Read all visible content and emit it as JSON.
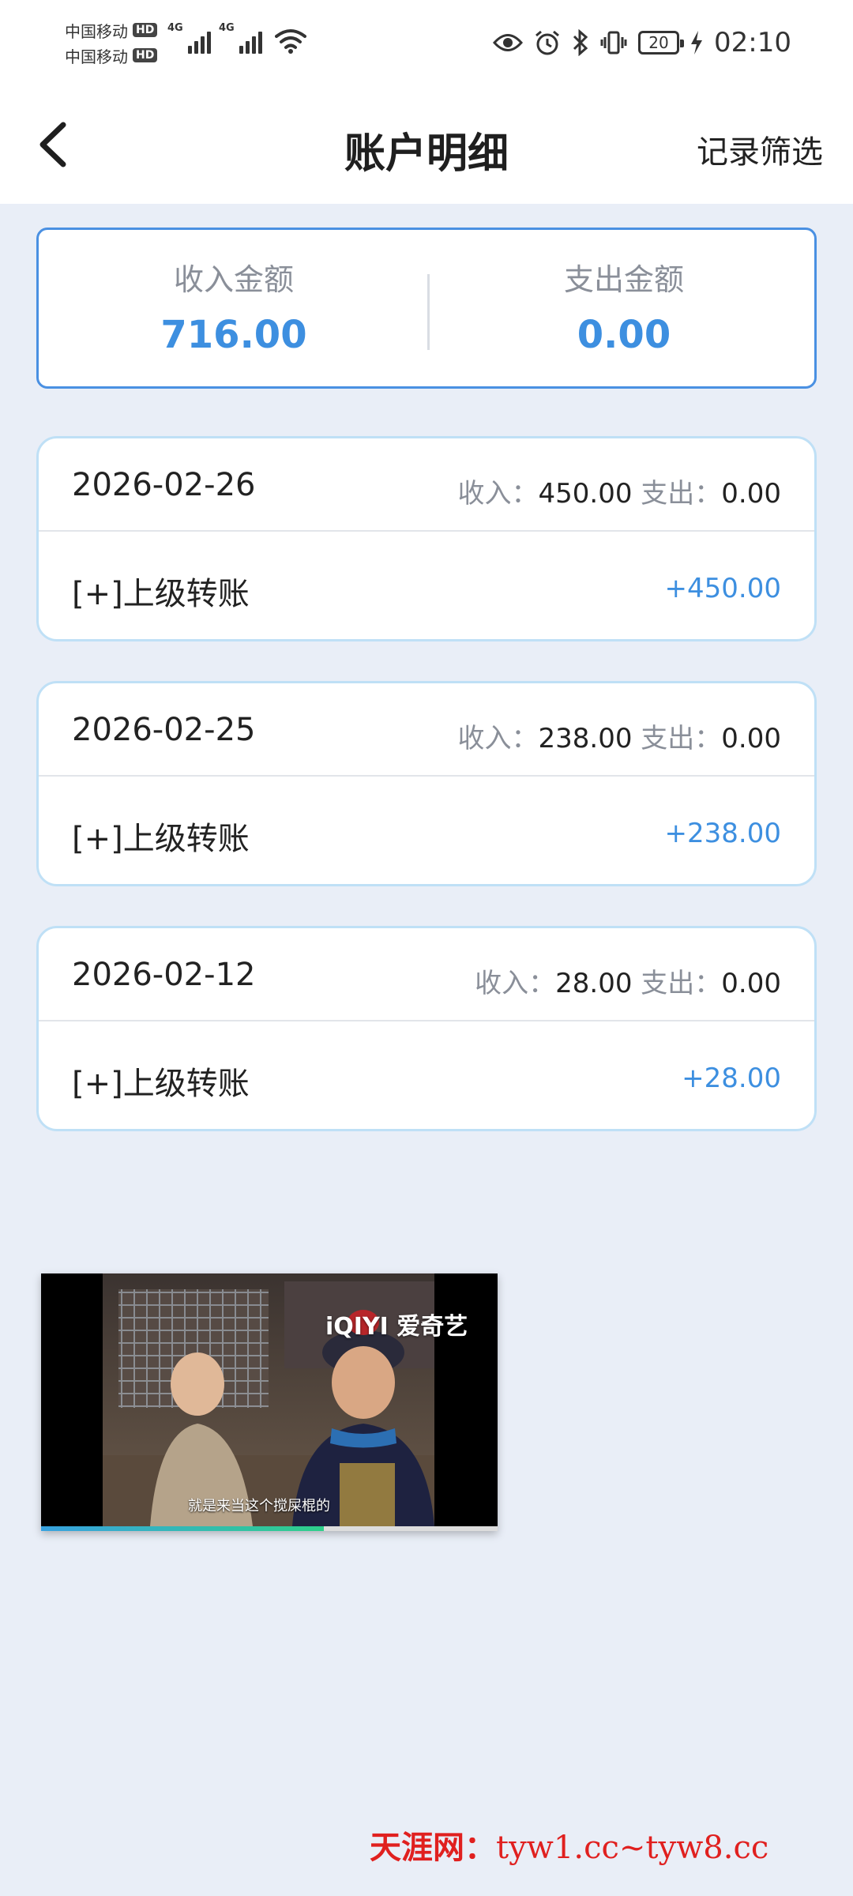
{
  "status_bar": {
    "carrier_1": "中国移动",
    "carrier_2": "中国移动",
    "hd_badge": "HD",
    "network_1": "4G",
    "network_2": "4G",
    "battery_level": "20",
    "time": "02:10",
    "icons": [
      "eye-icon",
      "alarm-icon",
      "bluetooth-icon",
      "vibrate-icon",
      "battery-icon",
      "charging-icon",
      "wifi-icon",
      "signal-icon"
    ]
  },
  "header": {
    "title": "账户明细",
    "filter_label": "记录筛选",
    "back_icon": "chevron-left-icon"
  },
  "summary": {
    "income_label": "收入金额",
    "income_value": "716.00",
    "expense_label": "支出金额",
    "expense_value": "0.00"
  },
  "labels": {
    "income": "收入：",
    "expense": "支出："
  },
  "records": [
    {
      "date": "2026-02-26",
      "income": "450.00",
      "expense": "0.00",
      "item_desc": "[+]上级转账",
      "item_amount": "+450.00"
    },
    {
      "date": "2026-02-25",
      "income": "238.00",
      "expense": "0.00",
      "item_desc": "[+]上级转账",
      "item_amount": "+238.00"
    },
    {
      "date": "2026-02-12",
      "income": "28.00",
      "expense": "0.00",
      "item_desc": "[+]上级转账",
      "item_amount": "+28.00"
    }
  ],
  "video": {
    "logo_text": "iQIYI 爱奇艺",
    "subtitle": "就是来当这个搅屎棍的",
    "progress": 0.62
  },
  "watermark": {
    "brand": "天涯网：",
    "domains": "tyw1.cc~tyw8.cc"
  },
  "colors": {
    "accent": "#3d8fe0",
    "page_bg": "#e9eef7",
    "card_border": "#bfe0f6",
    "summary_border": "#4a90e2",
    "muted_text": "#8a8f99",
    "watermark": "#e0201f"
  }
}
